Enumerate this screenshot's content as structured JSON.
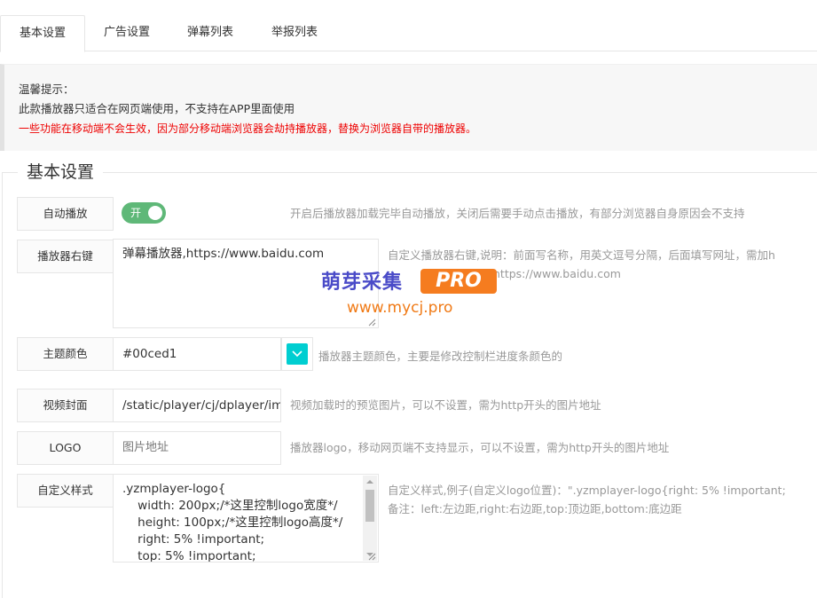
{
  "tabs": [
    {
      "label": "基本设置",
      "active": true
    },
    {
      "label": "广告设置",
      "active": false
    },
    {
      "label": "弹幕列表",
      "active": false
    },
    {
      "label": "举报列表",
      "active": false
    }
  ],
  "notice": {
    "line1": "温馨提示：",
    "line2": "此款播放器只适合在网页端使用，不支持在APP里面使用",
    "line3": "一些功能在移动端不会生效，因为部分移动端浏览器会劫持播放器，替换为浏览器自带的播放器。"
  },
  "section_title": "基本设置",
  "form": {
    "autoplay": {
      "label": "自动播放",
      "switch_text": "开",
      "hint": "开启后播放器加载完毕自动播放，关闭后需要手动点击播放，有部分浏览器自身原因会不支持"
    },
    "right_click": {
      "label": "播放器右键",
      "value": "弹幕播放器,https://www.baidu.com",
      "hint1": "自定义播放器右键,说明：前面写名称，用英文逗号分隔，后面填写网址，需加h",
      "hint2": "https://www.baidu.com"
    },
    "theme_color": {
      "label": "主题颜色",
      "value": "#00ced1",
      "hint": "播放器主题颜色，主要是修改控制栏进度条颜色的",
      "swatch_color": "#00ced1"
    },
    "cover": {
      "label": "视频封面",
      "value": "/static/player/cj/dplayer/im",
      "hint": "视频加载时的预览图片，可以不设置，需为http开头的图片地址"
    },
    "logo": {
      "label": "LOGO",
      "placeholder": "图片地址",
      "hint": "播放器logo，移动网页端不支持显示，可以不设置，需为http开头的图片地址"
    },
    "custom_style": {
      "label": "自定义样式",
      "value": ".yzmplayer-logo{\n    width: 200px;/*这里控制logo宽度*/\n    height: 100px;/*这里控制logo高度*/\n    right: 5% !important;\n    top: 5% !important;",
      "hint1": "自定义样式,例子(自定义logo位置)：\".yzmplayer-logo{right: 5% !important;",
      "hint2": "备注：left:左边距,right:右边距,top:顶边距,bottom:底边距"
    }
  },
  "watermark": {
    "brand": "萌芽采集",
    "badge": "PRO",
    "url": "www.mycj.pro"
  }
}
